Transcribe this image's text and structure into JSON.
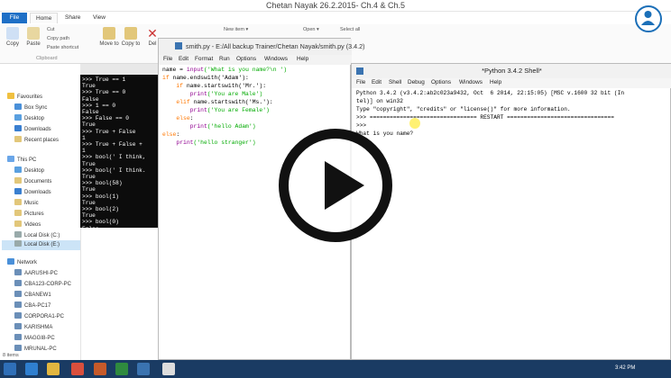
{
  "explorer": {
    "title": "Chetan Nayak 26.2.2015- Ch.4 & Ch.5",
    "tabs": [
      "File",
      "Home",
      "Share",
      "View"
    ],
    "ribbon": {
      "copy": "Copy",
      "paste": "Paste",
      "cut": "Cut",
      "copy_path": "Copy path",
      "paste_shortcut": "Paste shortcut",
      "move_to": "Move to",
      "copy_to": "Copy to",
      "delete": "Del",
      "clipboard": "Clipboard",
      "new_item": "New item ▾",
      "open": "Open ▾",
      "select_all": "Select all"
    },
    "nav": {
      "favourites": "Favourites",
      "fav_items": [
        "Box Sync",
        "Desktop",
        "Downloads",
        "Recent places"
      ],
      "this_pc": "This PC",
      "pc_items": [
        "Desktop",
        "Documents",
        "Downloads",
        "Music",
        "Pictures",
        "Videos",
        "Local Disk (C:)",
        "Local Disk (E:)"
      ],
      "network": "Network",
      "net_items": [
        "AARUSHI-PC",
        "CBA123-CORP-PC",
        "CBANEW1",
        "CBA-PC17",
        "CORPORA1-PC",
        "KARISHMA",
        "MAGGI8-PC",
        "MRUNAL-PC"
      ]
    },
    "status": "8 items"
  },
  "console": {
    "lines": [
      ">>> True == 1",
      "True",
      ">>> True == 0",
      "False",
      ">>> 1 == 0",
      "False",
      ">>> False == 0",
      "True",
      ">>> True + False",
      "1",
      ">>> True + False +",
      "1",
      ">>> bool(' I think,",
      "True",
      ">>> bool(' I think.",
      "True",
      ">>> bool(58)",
      "True",
      ">>> bool(1)",
      "True",
      ">>> bool(2)",
      "True",
      ">>> bool(0)",
      "False",
      ">>>"
    ]
  },
  "editor": {
    "title": "smith.py - E:/All backup Trainer/Chetan Nayak/smith.py (3.4.2)",
    "menu": [
      "File",
      "Edit",
      "Format",
      "Run",
      "Options",
      "Windows",
      "Help"
    ],
    "code": {
      "l1a": "name = ",
      "l1b": "input",
      "l1c": "('What is you name?\\n ')",
      "l2a": "if",
      "l2b": " name.endswith('Adam'):",
      "l3a": "    if",
      "l3b": " name.startswith('Mr.'):",
      "l4a": "        print",
      "l4b": "('You are Male')",
      "l5a": "    elif",
      "l5b": " name.startswith('Ms.'):",
      "l6a": "        print",
      "l6b": "('You are Female')",
      "l7a": "    else",
      "l7b": ":",
      "l8a": "        print",
      "l8b": "('hello Adam')",
      "l9a": "else",
      "l9b": ":",
      "l10a": "    print",
      "l10b": "('hello stranger')"
    }
  },
  "shell": {
    "title": "*Python 3.4.2 Shell*",
    "menu": [
      "File",
      "Edit",
      "Shell",
      "Debug",
      "Options",
      "Windows",
      "Help"
    ],
    "lines": [
      "Python 3.4.2 (v3.4.2:ab2c023a9432, Oct  6 2014, 22:15:05) [MSC v.1600 32 bit (In",
      "tel)] on win32",
      "Type \"copyright\", \"credits\" or \"license()\" for more information.",
      ">>> ================================ RESTART ================================",
      ">>> ",
      "What is you name?"
    ]
  },
  "taskbar": {
    "clock": "3:42 PM"
  }
}
